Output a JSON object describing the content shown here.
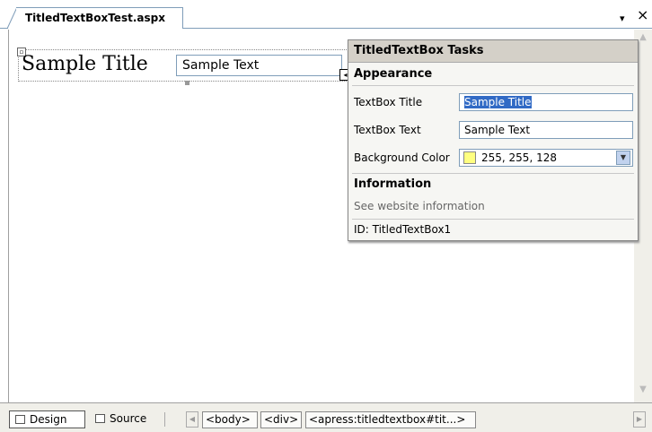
{
  "tab": {
    "title": "TitledTextBoxTest.aspx",
    "menu_glyph": "▾",
    "close_glyph": "×"
  },
  "design": {
    "title_text": "Sample Title",
    "textbox_value": "Sample Text",
    "smart_tag_glyph": "◂"
  },
  "tasks": {
    "header": "TitledTextBox Tasks",
    "appearance_heading": "Appearance",
    "rows": [
      {
        "label": "TextBox Title",
        "value": "Sample Title"
      },
      {
        "label": "TextBox Text",
        "value": "Sample Text"
      },
      {
        "label": "Background Color",
        "value": "255, 255, 128"
      }
    ],
    "background_color_hex": "#ffff80",
    "information_heading": "Information",
    "website_link": "See website information",
    "id_line": "ID: TitledTextBox1"
  },
  "bottom": {
    "design_label": "Design",
    "source_label": "Source",
    "crumbs": [
      "<body>",
      "<div>",
      "<apress:titledtextbox#tit...>"
    ]
  },
  "icons": {
    "design": "design-view-icon",
    "source": "source-view-icon"
  }
}
